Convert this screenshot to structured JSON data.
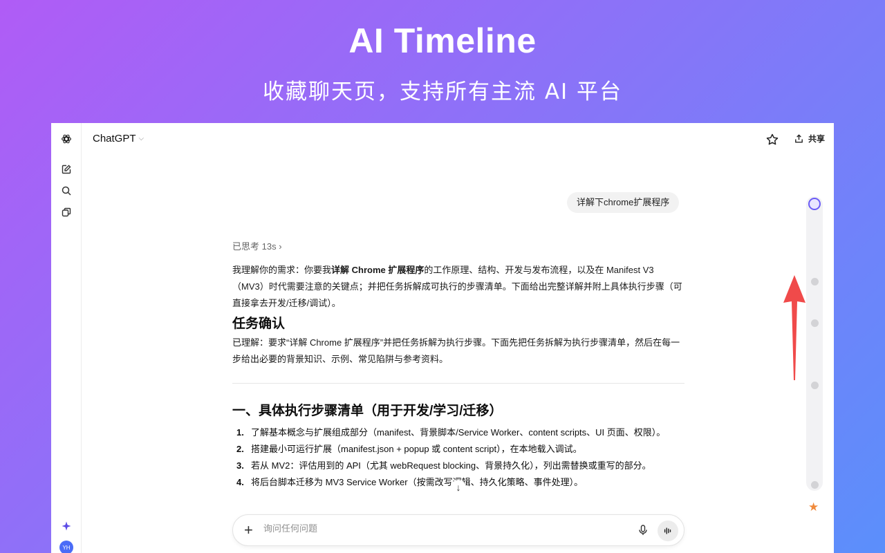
{
  "hero": {
    "title": "AI Timeline",
    "subtitle": "收藏聊天页，支持所有主流 AI 平台"
  },
  "header": {
    "model": "ChatGPT",
    "share_label": "共享",
    "more_label": "···"
  },
  "sidebar": {
    "avatar_initials": "YH",
    "icons": [
      "chatgpt-logo-icon",
      "new-chat-icon",
      "search-icon",
      "library-icon",
      "sparkle-icon"
    ]
  },
  "chat": {
    "user_message": "详解下chrome扩展程序",
    "thought_label": "已思考 13s",
    "intro_a": "我理解你的需求：你要我",
    "intro_bold": "详解 Chrome 扩展程序",
    "intro_b": "的工作原理、结构、开发与发布流程，以及在 Manifest V3（MV3）时代需要注意的关键点；并把任务拆解成可执行的步骤清单。下面给出完整详解并附上具体执行步骤（可直接拿去开发/迁移/调试）。",
    "heading_task": "任务确认",
    "task_para": "已理解：要求“详解 Chrome 扩展程序”并把任务拆解为执行步骤。下面先把任务拆解为执行步骤清单，然后在每一步给出必要的背景知识、示例、常见陷阱与参考资料。",
    "heading_steps": "一、具体执行步骤清单（用于开发/学习/迁移）",
    "steps": [
      {
        "num": "1.",
        "text": "了解基本概念与扩展组成部分（manifest、背景脚本/Service Worker、content scripts、UI 页面、权限）。"
      },
      {
        "num": "2.",
        "text": "搭建最小可运行扩展（manifest.json + popup 或 content script），在本地载入调试。"
      },
      {
        "num": "3.",
        "text": "若从 MV2：评估用到的 API（尤其 webRequest blocking、背景持久化），列出需替换或重写的部分。"
      },
      {
        "num": "4.",
        "text": "将后台脚本迁移为 MV3 Service Worker（按需改写逻辑、持久化策略、事件处理）。"
      }
    ]
  },
  "composer": {
    "placeholder": "询问任何问题"
  },
  "colors": {
    "accent": "#6b5cf6",
    "arrow": "#f04a4a",
    "star": "#f08a3c"
  }
}
